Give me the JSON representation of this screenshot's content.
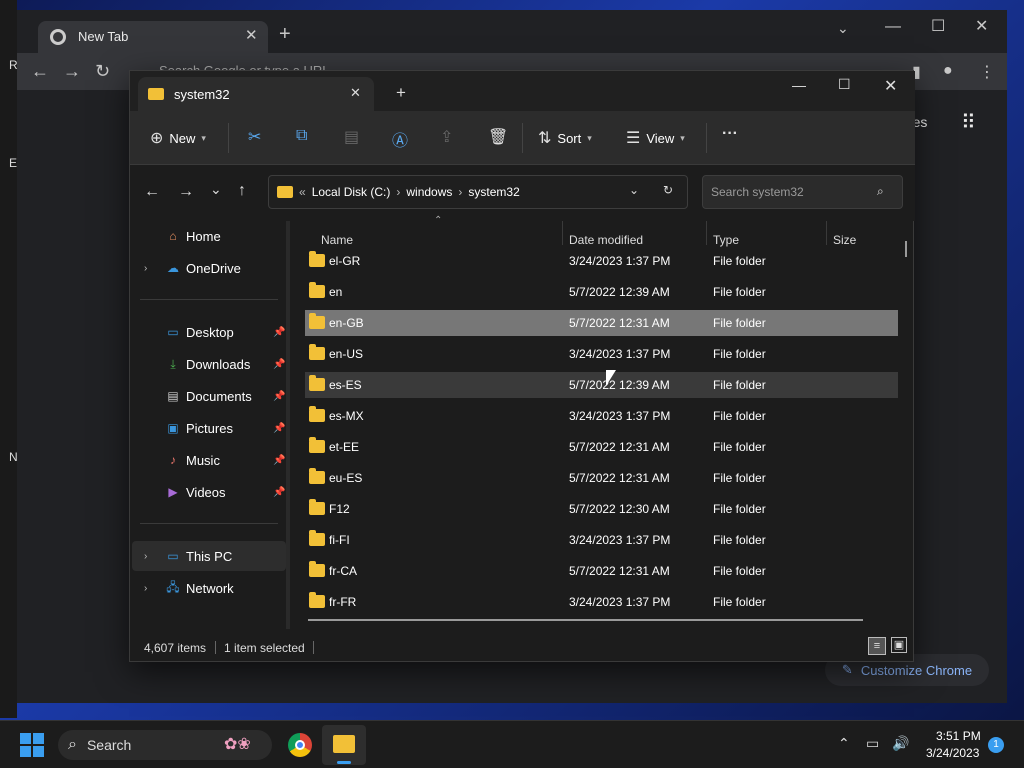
{
  "desktop": {
    "letters": [
      "R",
      "E",
      "N"
    ]
  },
  "chrome": {
    "tab_title": "New Tab",
    "omnibox_placeholder": "Search Google or type a URL",
    "partial_link": "ages",
    "customize_label": "Customize Chrome"
  },
  "explorer": {
    "tab_title": "system32",
    "toolbar": {
      "new_label": "New",
      "sort_label": "Sort",
      "view_label": "View"
    },
    "breadcrumb": [
      "Local Disk (C:)",
      "windows",
      "system32"
    ],
    "search_placeholder": "Search system32",
    "sidebar": {
      "home": "Home",
      "onedrive": "OneDrive",
      "desktop": "Desktop",
      "downloads": "Downloads",
      "documents": "Documents",
      "pictures": "Pictures",
      "music": "Music",
      "videos": "Videos",
      "this_pc": "This PC",
      "network": "Network"
    },
    "columns": {
      "name": "Name",
      "date": "Date modified",
      "type": "Type",
      "size": "Size"
    },
    "rows": [
      {
        "name": "el-GR",
        "date": "3/24/2023 1:37 PM",
        "type": "File folder"
      },
      {
        "name": "en",
        "date": "5/7/2022 12:39 AM",
        "type": "File folder"
      },
      {
        "name": "en-GB",
        "date": "5/7/2022 12:31 AM",
        "type": "File folder"
      },
      {
        "name": "en-US",
        "date": "3/24/2023 1:37 PM",
        "type": "File folder"
      },
      {
        "name": "es-ES",
        "date": "5/7/2022 12:39 AM",
        "type": "File folder"
      },
      {
        "name": "es-MX",
        "date": "3/24/2023 1:37 PM",
        "type": "File folder"
      },
      {
        "name": "et-EE",
        "date": "5/7/2022 12:31 AM",
        "type": "File folder"
      },
      {
        "name": "eu-ES",
        "date": "5/7/2022 12:31 AM",
        "type": "File folder"
      },
      {
        "name": "F12",
        "date": "5/7/2022 12:30 AM",
        "type": "File folder"
      },
      {
        "name": "fi-FI",
        "date": "3/24/2023 1:37 PM",
        "type": "File folder"
      },
      {
        "name": "fr-CA",
        "date": "5/7/2022 12:31 AM",
        "type": "File folder"
      },
      {
        "name": "fr-FR",
        "date": "3/24/2023 1:37 PM",
        "type": "File folder"
      }
    ],
    "status": {
      "items": "4,607 items",
      "selected": "1 item selected"
    }
  },
  "taskbar": {
    "search_label": "Search",
    "time": "3:51 PM",
    "date": "3/24/2023",
    "notification_count": "1"
  },
  "colors": {
    "selected_row": "#777777",
    "hover_row": "#3a3a3a",
    "folder": "#f2c037",
    "accent": "#0078d4"
  }
}
